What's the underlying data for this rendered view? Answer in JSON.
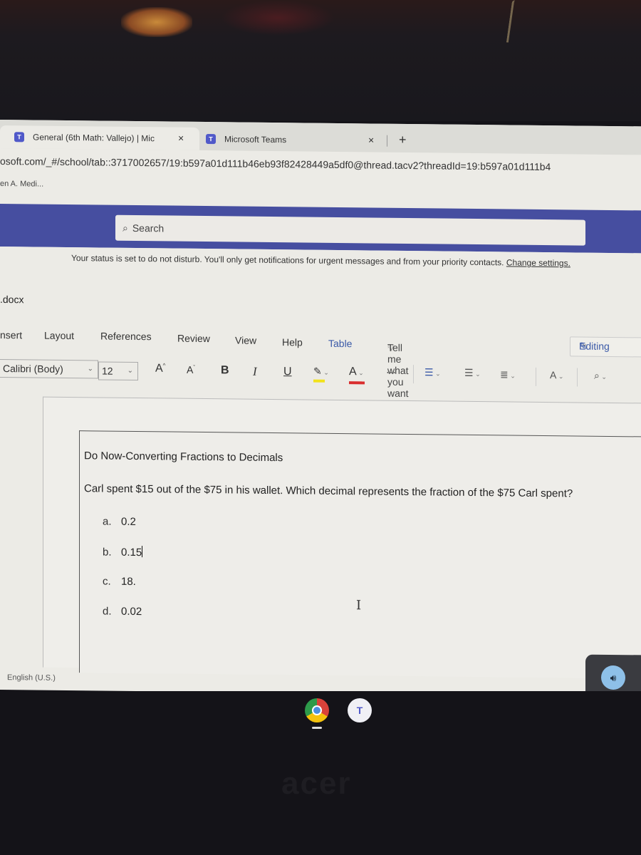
{
  "browser": {
    "tabs": [
      {
        "title": "General (6th Math: Vallejo) | Mic",
        "active": true
      },
      {
        "title": "Microsoft Teams",
        "active": false
      }
    ],
    "close_glyph": "×",
    "new_tab_glyph": "+",
    "address": "osoft.com/_#/school/tab::3717002657/19:b597a01d111b46eb93f82428449a5df0@thread.tacv2?threadId=19:b597a01d111b4",
    "bookmark": "en A. Medi..."
  },
  "teams": {
    "search_placeholder": "Search",
    "search_icon": "search-icon",
    "dnd_message": "Your status is set to do not disturb. You'll only get notifications for urgent messages and from your priority contacts.",
    "change_settings": "Change settings.",
    "header_color": "#464ea0"
  },
  "word": {
    "doc_name": ".docx",
    "ribbon_tabs": [
      "nsert",
      "Layout",
      "References",
      "Review",
      "View",
      "Help",
      "Table"
    ],
    "tell_me": "Tell me what you want to do",
    "editing": "Editing",
    "font": "Calibri (Body)",
    "font_size": "12",
    "toolbar": {
      "grow_font": "A",
      "shrink_font": "A",
      "bold": "B",
      "italic": "I",
      "underline": "U",
      "font_color": "A",
      "more": "···"
    },
    "status_language": "English (U.S.)"
  },
  "document": {
    "title": "Do Now-Converting Fractions to Decimals",
    "question": "Carl spent $15 out of the $75 in his wallet. Which decimal represents the fraction of the $75 Carl spent?",
    "options": [
      {
        "letter": "a.",
        "value": "0.2"
      },
      {
        "letter": "b.",
        "value": "0.15"
      },
      {
        "letter": "c.",
        "value": "18."
      },
      {
        "letter": "d.",
        "value": "0.02"
      }
    ]
  },
  "shelf": {
    "apps": [
      "Chrome",
      "Microsoft Teams"
    ],
    "teams_glyph": "T"
  },
  "brand": "acer"
}
